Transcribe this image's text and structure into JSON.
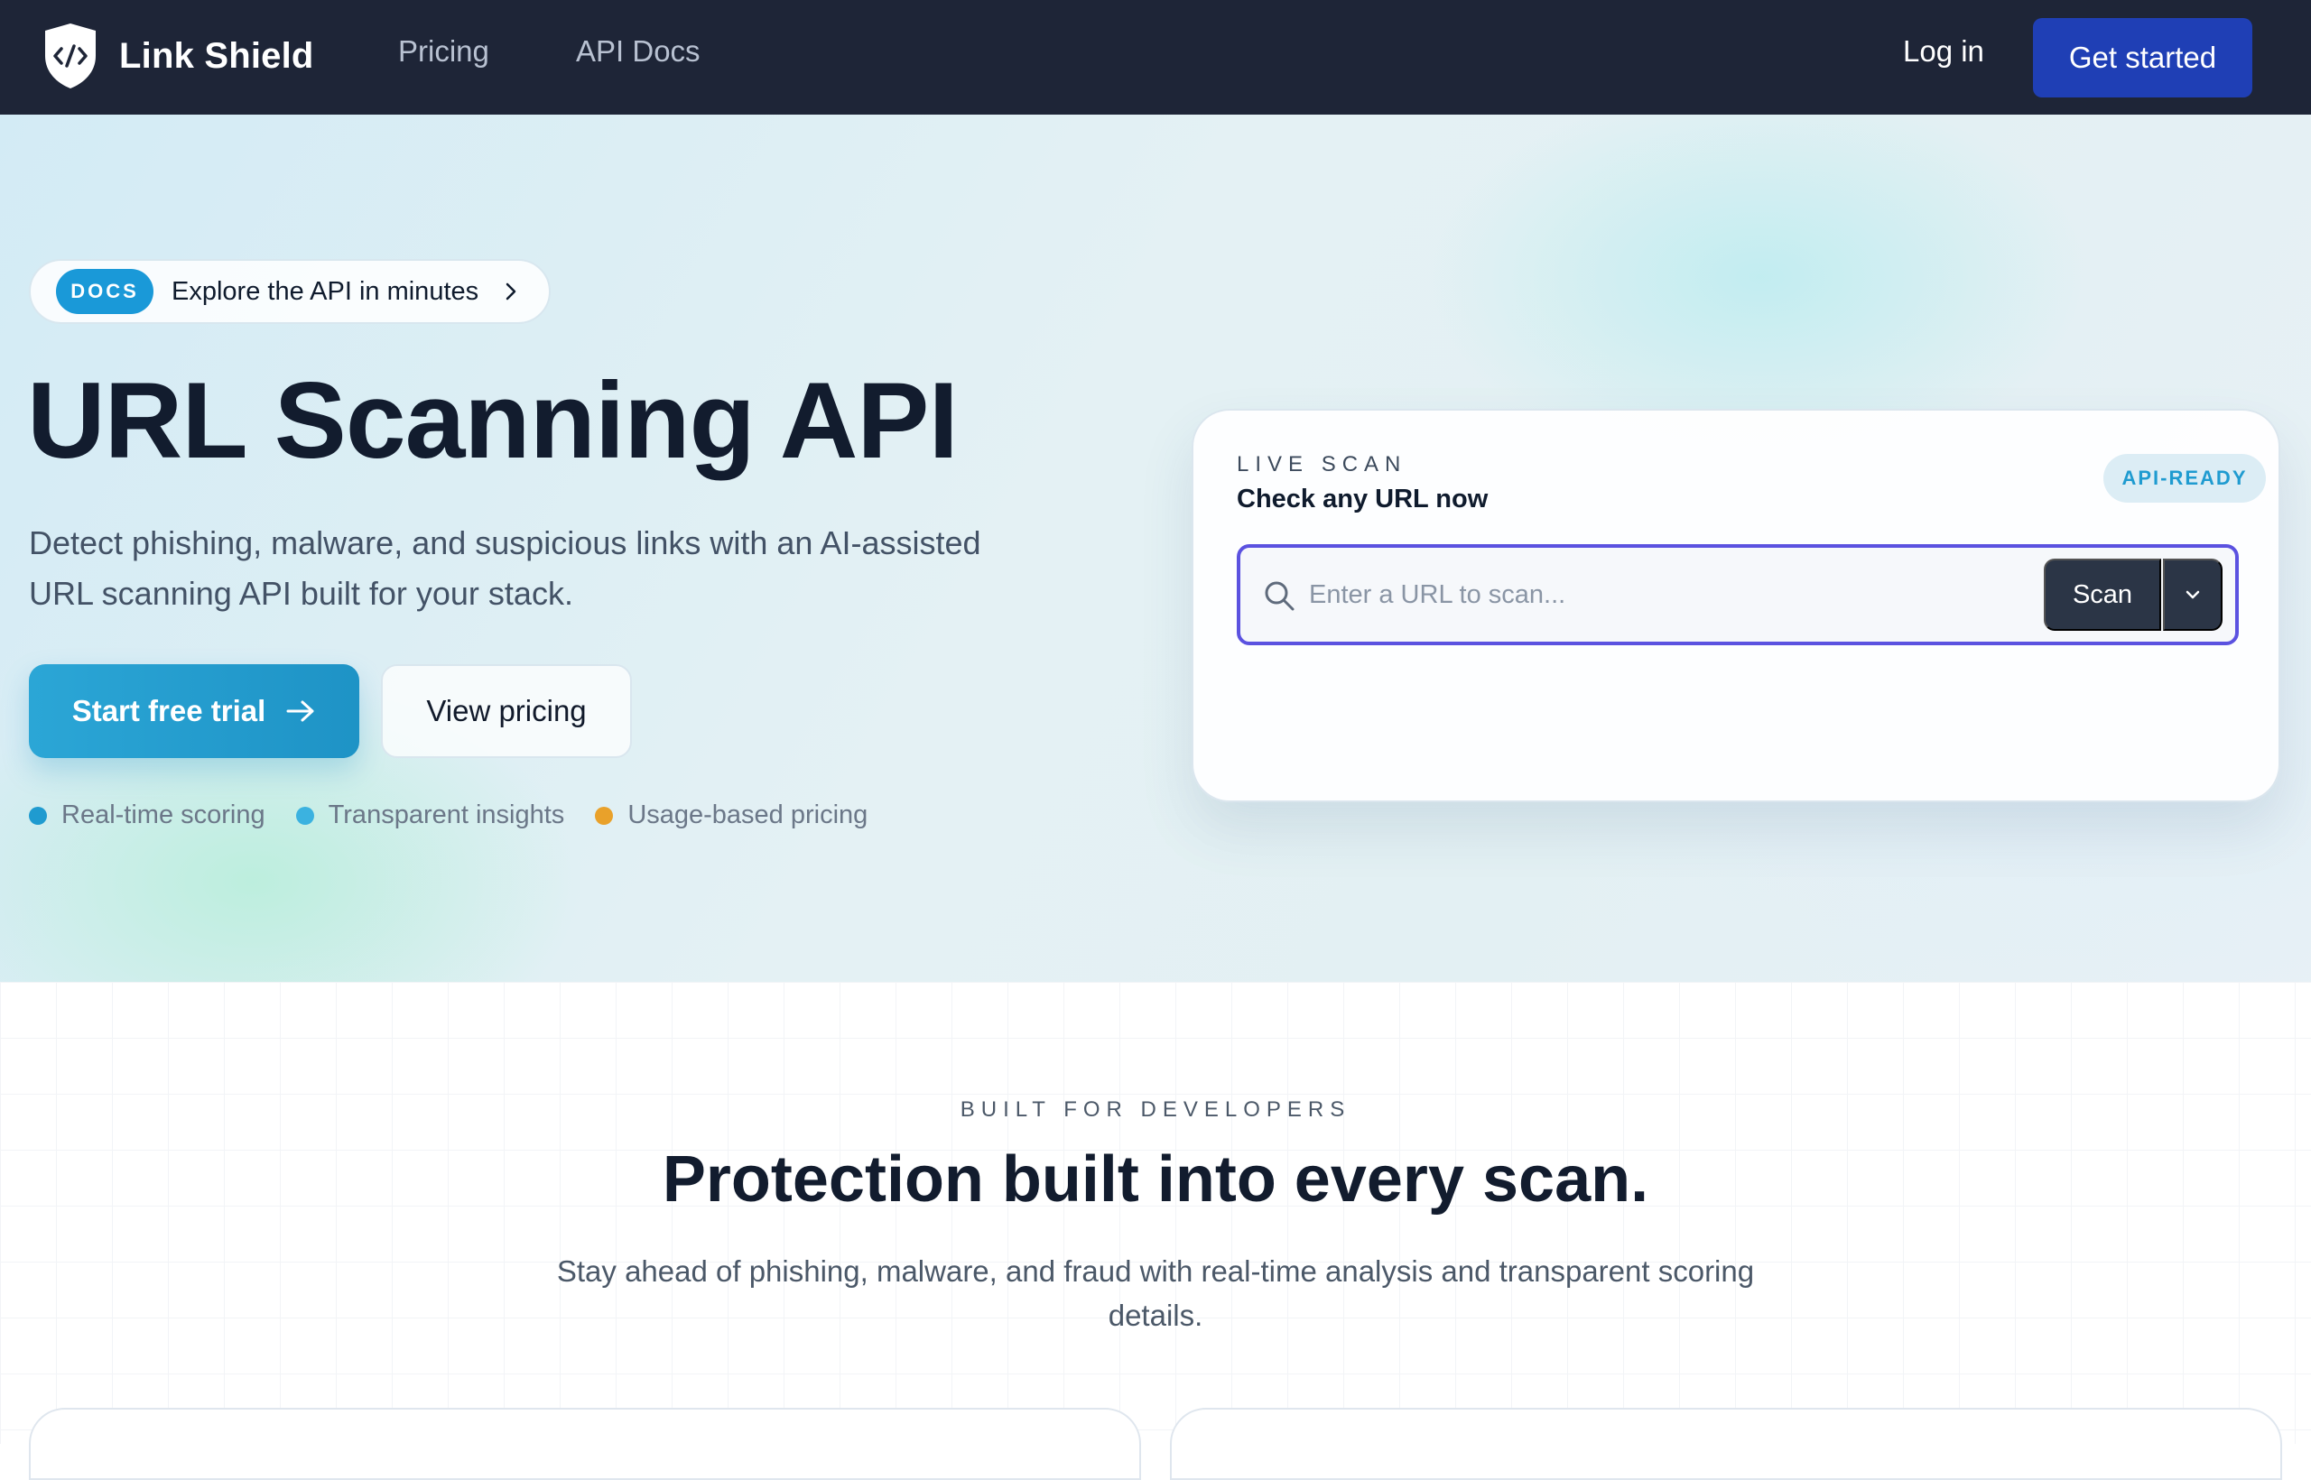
{
  "nav": {
    "brand": "Link Shield",
    "links": [
      "Pricing",
      "API Docs"
    ],
    "login": "Log in",
    "cta": "Get started"
  },
  "hero": {
    "badge": "DOCS",
    "badge_text": "Explore the API in minutes",
    "title": "URL Scanning API",
    "subtitle": "Detect phishing, malware, and suspicious links with an AI-assisted URL scanning API built for your stack.",
    "primary_button": "Start free trial",
    "secondary_button": "View pricing",
    "features": [
      {
        "label": "Real-time scoring",
        "color": "#1f9bd0"
      },
      {
        "label": "Transparent insights",
        "color": "#3bb2e0"
      },
      {
        "label": "Usage-based pricing",
        "color": "#e9a12a"
      }
    ]
  },
  "scan": {
    "eyebrow": "LIVE SCAN",
    "heading": "Check any URL now",
    "badge": "API-READY",
    "placeholder": "Enter a URL to scan...",
    "button": "Scan"
  },
  "section": {
    "eyebrow": "BUILT FOR DEVELOPERS",
    "title": "Protection built into every scan.",
    "subtitle": "Stay ahead of phishing, malware, and fraud with real-time analysis and transparent scoring details."
  },
  "icons": {
    "brand": "shield-code-icon",
    "chevron": "chevron-right-icon",
    "arrow": "arrow-right-icon",
    "search": "search-icon",
    "dropdown": "chevron-down-icon"
  },
  "colors": {
    "nav_bg": "#1e2537",
    "cta": "#1f3fb5",
    "accent": "#1f9bd0",
    "input_focus": "#5b52e0",
    "scan_button": "#2b3546"
  }
}
